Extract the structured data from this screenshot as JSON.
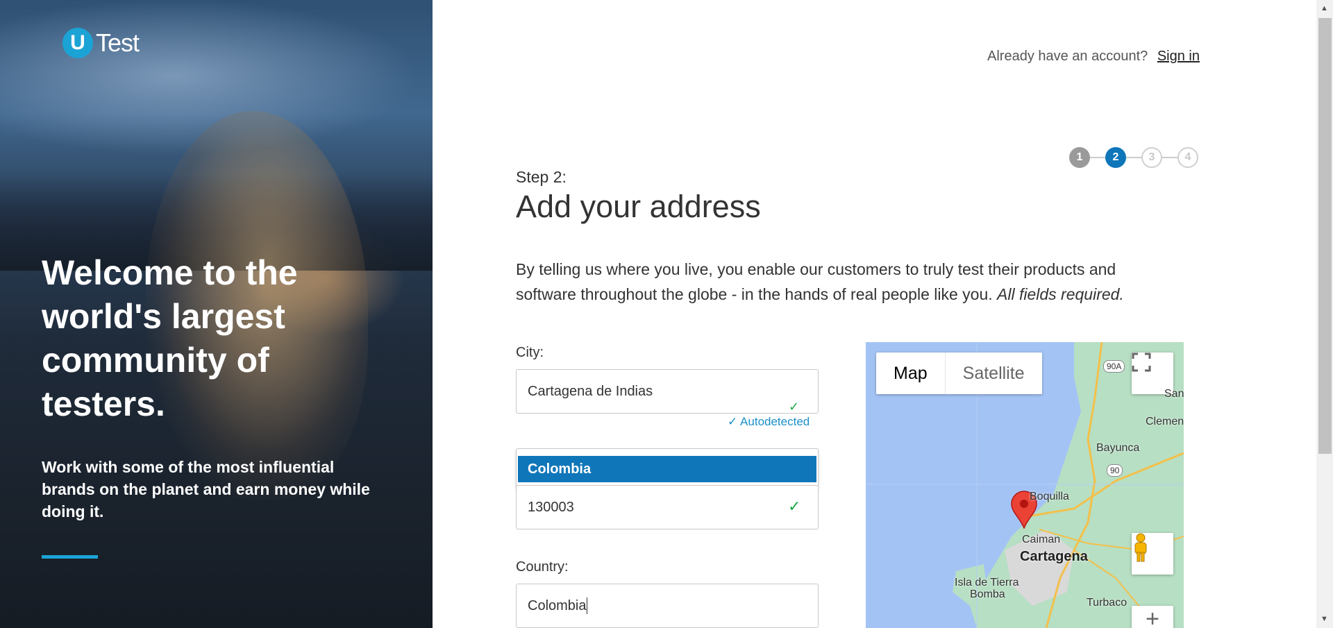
{
  "brand": {
    "logo_letter": "U",
    "logo_text": "Test",
    "accent": "#1ca3d6",
    "primary": "#0f76b9"
  },
  "hero": {
    "title": "Welcome to the world's largest community of testers.",
    "subtitle": "Work with some of the most influential brands on the planet and earn money while doing it."
  },
  "header": {
    "account_prompt": "Already have an account?",
    "signin_label": "Sign in"
  },
  "stepper": {
    "steps": [
      "1",
      "2",
      "3",
      "4"
    ],
    "current": 2
  },
  "form": {
    "step_label": "Step 2:",
    "title": "Add your address",
    "intro": "By telling us where you live, you enable our customers to truly test their products and software throughout the globe - in the hands of real people like you.",
    "intro_emphasis": "All fields required.",
    "city_label": "City:",
    "city_value": "Cartagena de Indias",
    "autodetected_label": "Autodetected",
    "dropdown_option": "Colombia",
    "zip_value": "130003",
    "country_label": "Country:",
    "country_value": "Colombia"
  },
  "map": {
    "map_label": "Map",
    "satellite_label": "Satellite",
    "places": {
      "san": "San",
      "clemente": "Clemen",
      "bayunca": "Bayunca",
      "boquilla": "Boquilla",
      "caiman": "Caiman",
      "cartagena": "Cartagena",
      "isla": "Isla de Tierra",
      "bomba": "Bomba",
      "turbaco": "Turbaco"
    },
    "roads": {
      "r90a": "90A",
      "r90": "90"
    }
  }
}
